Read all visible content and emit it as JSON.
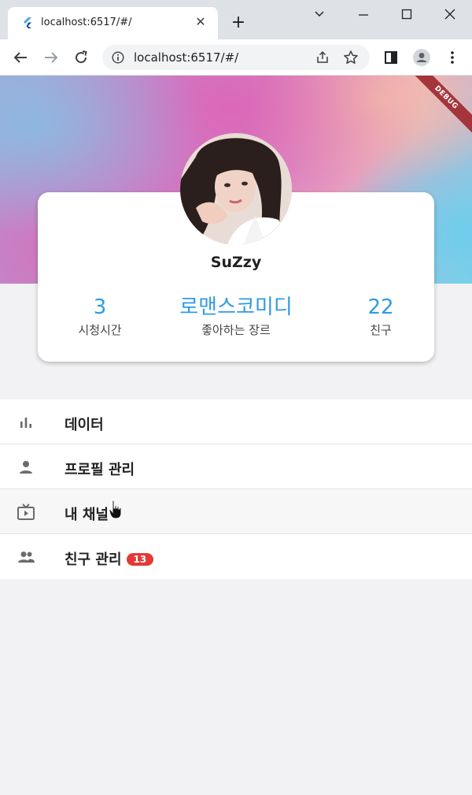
{
  "browser": {
    "tab_title": "localhost:6517/#/",
    "url": "localhost:6517/#/",
    "new_tab_glyph": "+",
    "close_glyph": "✕"
  },
  "app": {
    "debug_banner": "DEBUG",
    "profile": {
      "name": "SuZzy",
      "stats": [
        {
          "value": "3",
          "label": "시청시간"
        },
        {
          "value": "로맨스코미디",
          "label": "좋아하는 장르"
        },
        {
          "value": "22",
          "label": "친구"
        }
      ]
    },
    "menu": [
      {
        "label": "데이터",
        "icon": "bar-chart-icon"
      },
      {
        "label": "프로필 관리",
        "icon": "person-icon"
      },
      {
        "label": "내 채널",
        "icon": "tv-icon"
      },
      {
        "label": "친구 관리",
        "icon": "people-icon",
        "badge": "13"
      }
    ],
    "colors": {
      "accent": "#2f9be4",
      "badge": "#e53935",
      "debug": "#a3353b"
    }
  }
}
